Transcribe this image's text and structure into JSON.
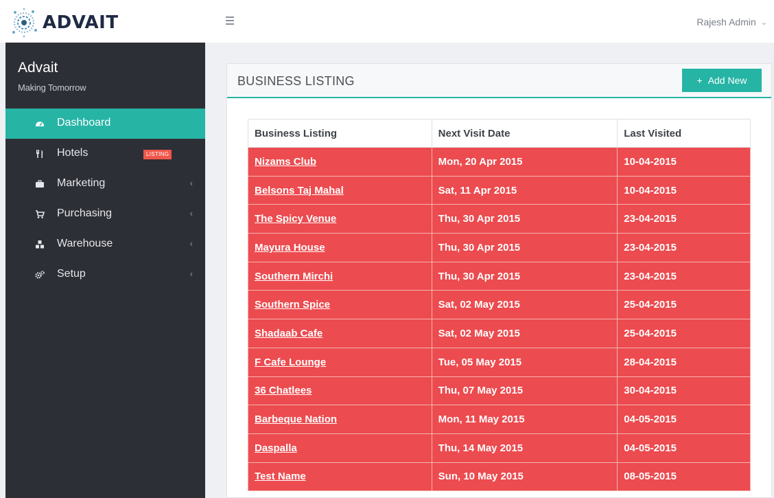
{
  "header": {
    "logo_text": "ADVAIT",
    "user_name": "Rajesh Admin",
    "user_chevron": "⌄"
  },
  "sidebar": {
    "brand_name": "Advait",
    "brand_tagline": "Making Tomorrow",
    "items": [
      {
        "label": "Dashboard",
        "icon": "dashboard-icon",
        "active": true
      },
      {
        "label": "Hotels",
        "icon": "cutlery-icon",
        "badge": "LISTING"
      },
      {
        "label": "Marketing",
        "icon": "briefcase-icon",
        "chevron": "‹"
      },
      {
        "label": "Purchasing",
        "icon": "cart-icon",
        "chevron": "‹"
      },
      {
        "label": "Warehouse",
        "icon": "cubes-icon",
        "chevron": "‹"
      },
      {
        "label": "Setup",
        "icon": "cogs-icon",
        "chevron": "‹"
      }
    ]
  },
  "panel": {
    "title": "BUSINESS LISTING",
    "add_label": "Add New",
    "add_icon": "+"
  },
  "table": {
    "columns": [
      "Business Listing",
      "Next Visit Date",
      "Last Visited"
    ],
    "rows": [
      [
        "Nizams Club",
        "Mon, 20 Apr 2015",
        "10-04-2015"
      ],
      [
        "Belsons Taj Mahal",
        "Sat, 11 Apr 2015",
        "10-04-2015"
      ],
      [
        "The Spicy Venue",
        "Thu, 30 Apr 2015",
        "23-04-2015"
      ],
      [
        "Mayura House",
        "Thu, 30 Apr 2015",
        "23-04-2015"
      ],
      [
        "Southern Mirchi",
        "Thu, 30 Apr 2015",
        "23-04-2015"
      ],
      [
        "Southern Spice",
        "Sat, 02 May 2015",
        "25-04-2015"
      ],
      [
        "Shadaab Cafe",
        "Sat, 02 May 2015",
        "25-04-2015"
      ],
      [
        "F Cafe Lounge",
        "Tue, 05 May 2015",
        "28-04-2015"
      ],
      [
        "36 Chatlees",
        "Thu, 07 May 2015",
        "30-04-2015"
      ],
      [
        "Barbeque Nation",
        "Mon, 11 May 2015",
        "04-05-2015"
      ],
      [
        "Daspalla",
        "Thu, 14 May 2015",
        "04-05-2015"
      ],
      [
        "Test Name",
        "Sun, 10 May 2015",
        "08-05-2015"
      ]
    ]
  },
  "colors": {
    "accent": "#26b4a5",
    "sidebar_bg": "#2d2f36",
    "row_red": "#ec4b4f",
    "badge_red": "#f0564a"
  }
}
